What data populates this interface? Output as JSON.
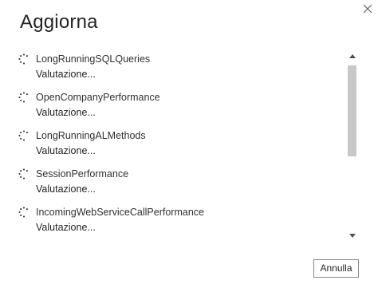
{
  "dialog": {
    "title": "Aggiorna",
    "close_icon": "close-icon",
    "cancel_label": "Annulla"
  },
  "items": [
    {
      "name": "LongRunningSQLQueries",
      "status": "Valutazione...",
      "icon": "loading-spinner-icon"
    },
    {
      "name": "OpenCompanyPerformance",
      "status": "Valutazione...",
      "icon": "loading-spinner-icon"
    },
    {
      "name": "LongRunningALMethods",
      "status": "Valutazione...",
      "icon": "loading-spinner-icon"
    },
    {
      "name": "SessionPerformance",
      "status": "Valutazione...",
      "icon": "loading-spinner-icon"
    },
    {
      "name": "IncomingWebServiceCallPerformance",
      "status": "Valutazione...",
      "icon": "loading-spinner-icon"
    }
  ],
  "scrollbar": {
    "up_icon": "scroll-up-arrow-icon",
    "down_icon": "scroll-down-arrow-icon"
  },
  "colors": {
    "text": "#252423",
    "scroll_thumb": "#c8c8c8",
    "button_border": "#8a8886"
  }
}
